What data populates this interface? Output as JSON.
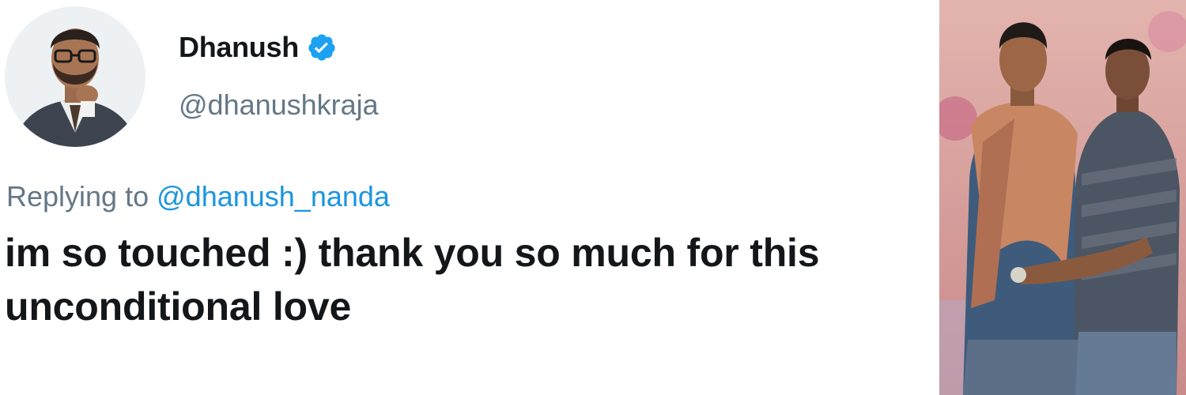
{
  "tweet": {
    "display_name": "Dhanush",
    "verified": true,
    "handle": "@dhanushkraja",
    "reply_prefix": "Replying to",
    "reply_to_handle": "@dhanush_nanda",
    "text": "im so touched :) thank you so much for this unconditional love"
  },
  "icons": {
    "verified": "verified-badge-icon",
    "avatar": "profile-avatar",
    "photo": "embedded-photo"
  },
  "colors": {
    "name_text": "#14171a",
    "muted_text": "#657786",
    "link": "#1b95e0",
    "verified_badge": "#1da1f2"
  }
}
